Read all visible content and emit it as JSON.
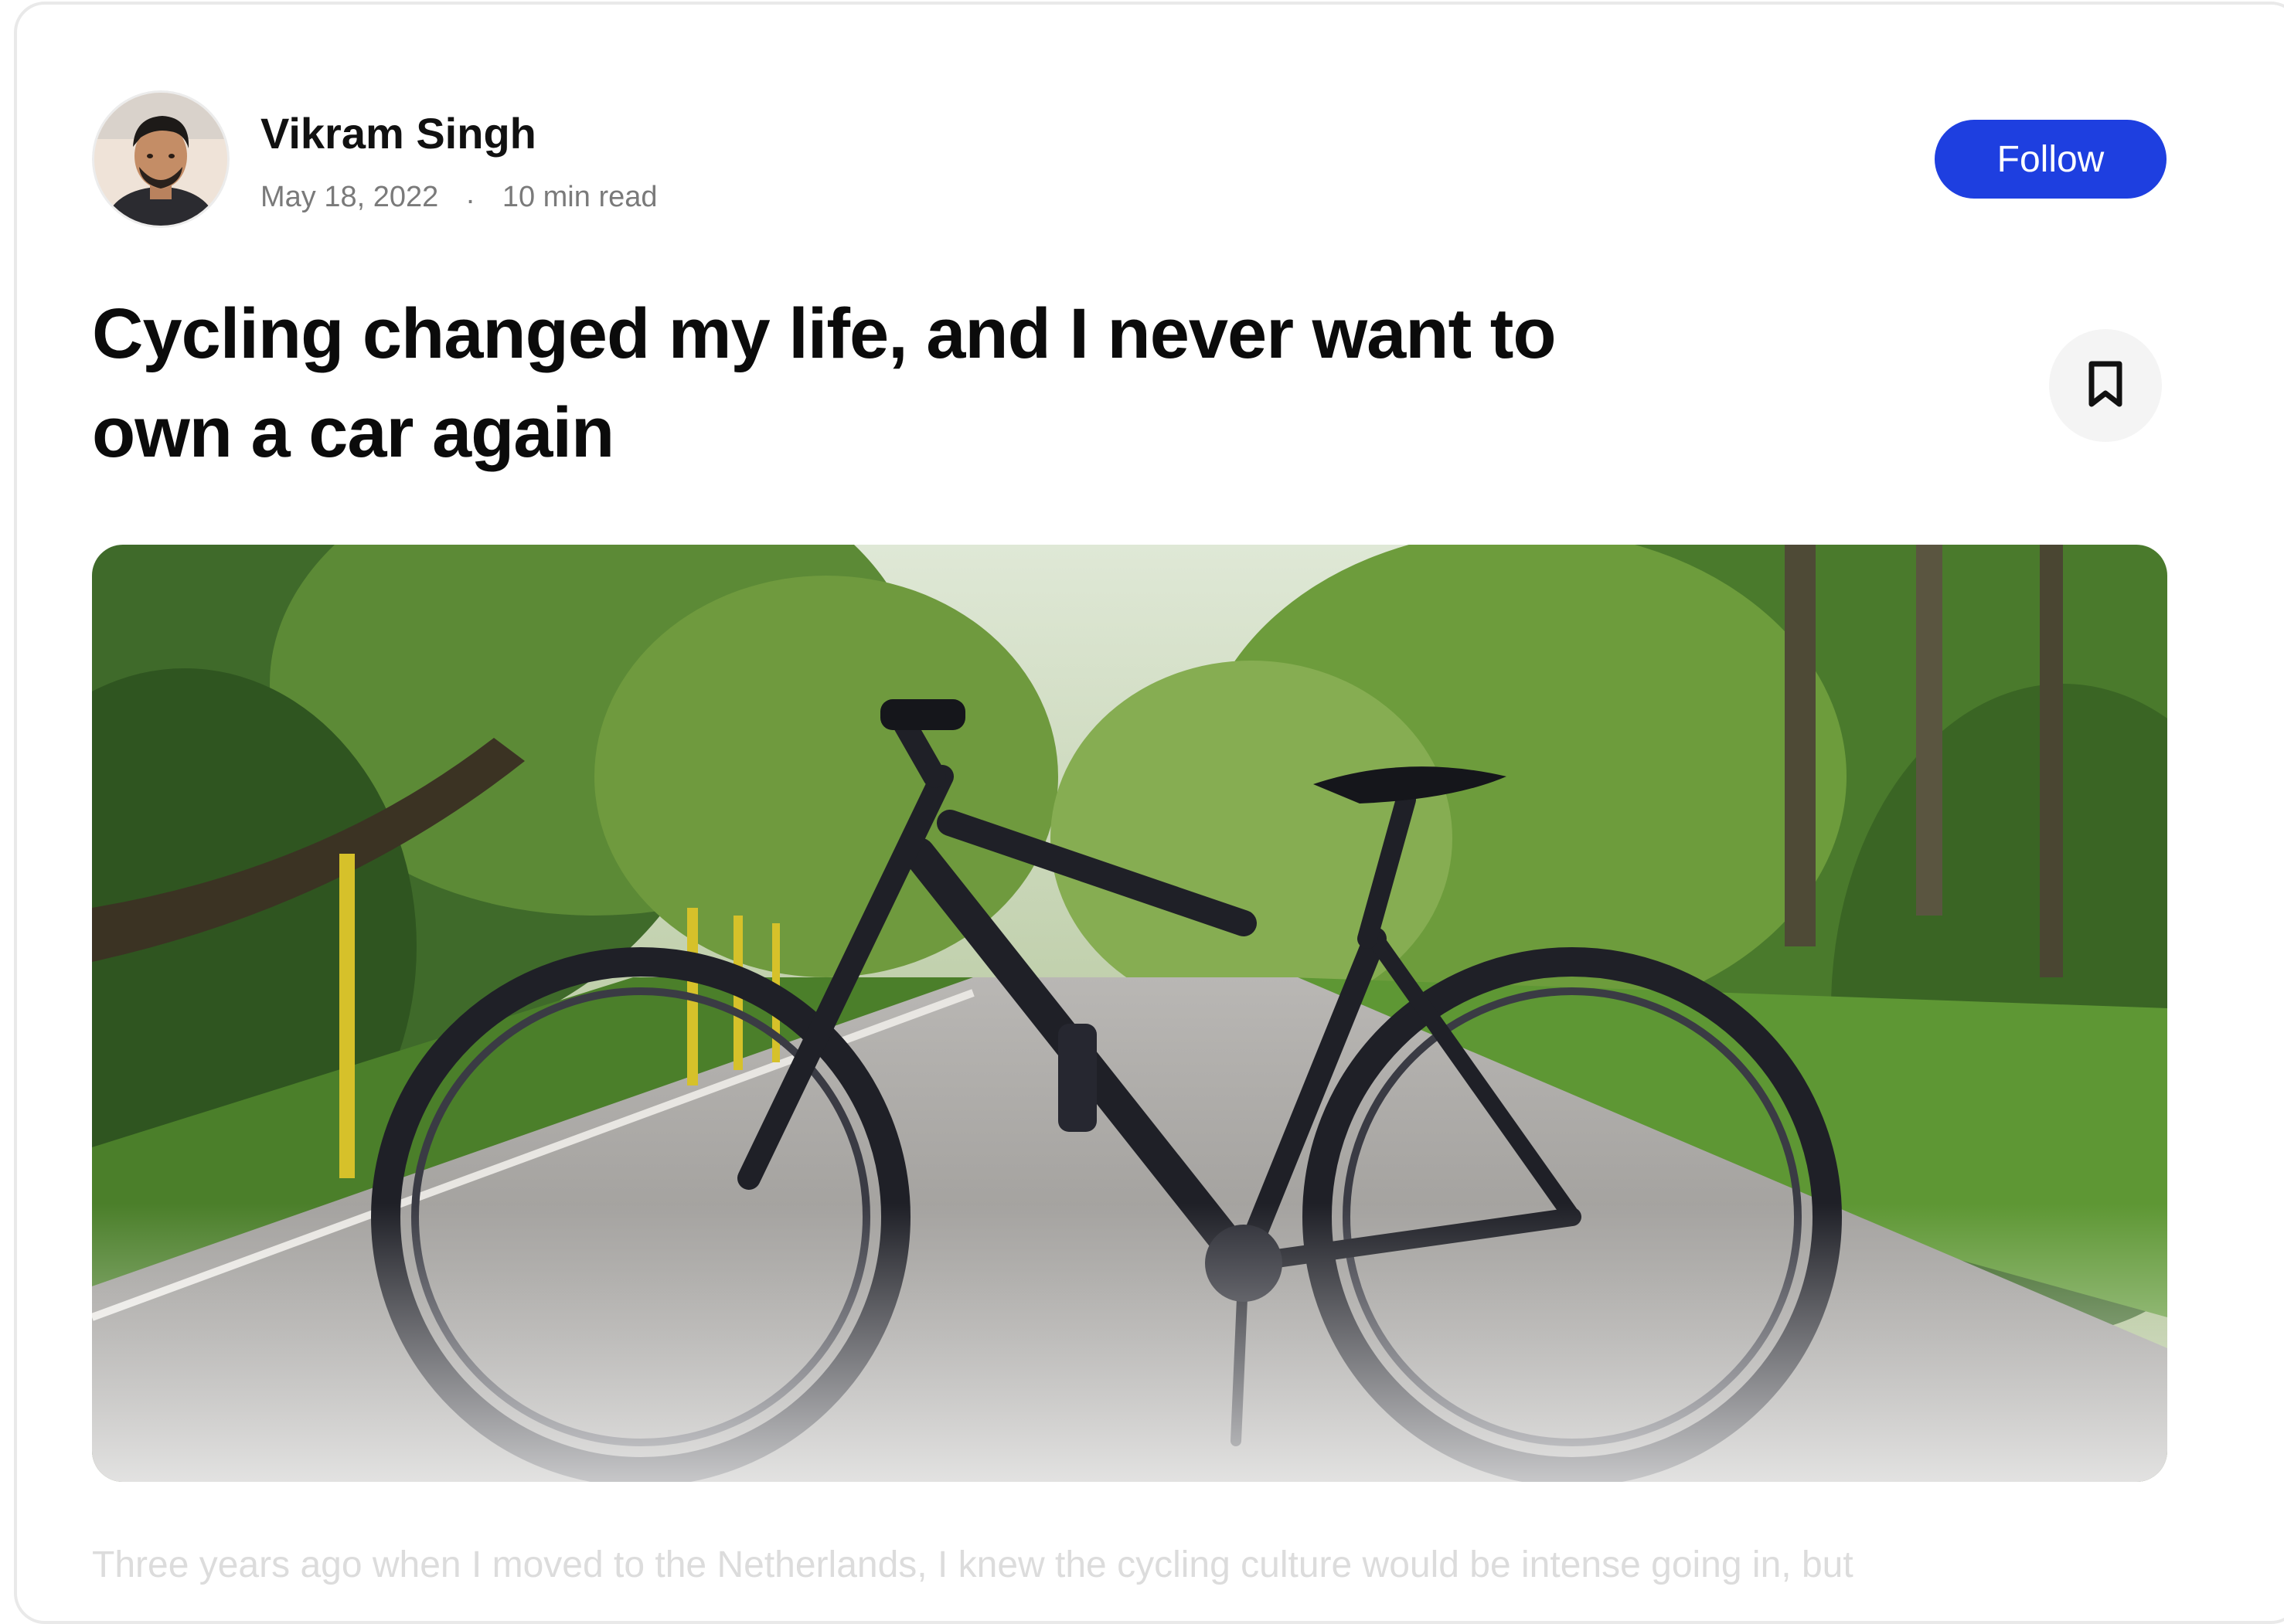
{
  "author": {
    "name": "Vikram Singh",
    "date": "May 18, 2022",
    "separator": ".",
    "read_time": "10 min read"
  },
  "actions": {
    "follow_label": "Follow",
    "bookmark_icon": "bookmark-icon"
  },
  "article": {
    "title": "Cycling changed my life, and I never want to own a car again",
    "excerpt": "Three years ago when I moved to the Netherlands, I knew the cycling culture would be intense going in, but"
  },
  "colors": {
    "accent": "#1e3fe0",
    "title_text": "#0b0b0b",
    "meta_text": "#7a7a7a",
    "excerpt_text": "#dcdcdc"
  }
}
